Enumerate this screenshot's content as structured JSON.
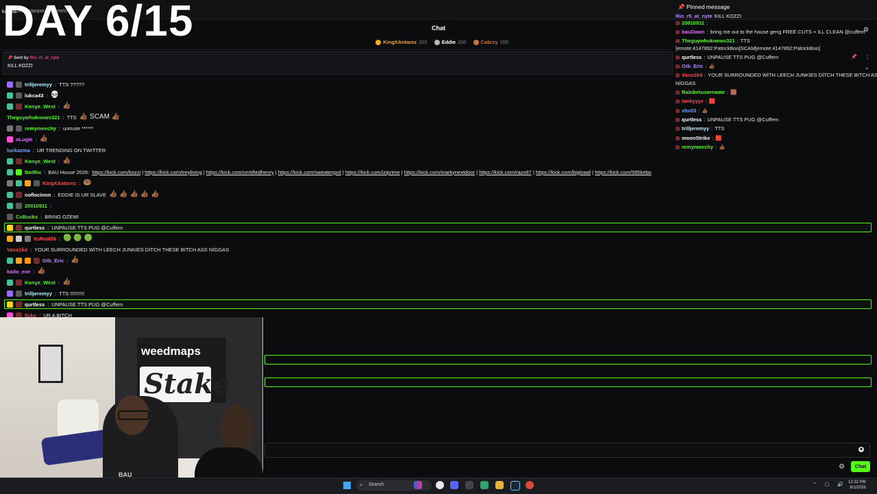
{
  "window": {
    "url": "kick.com/popout/cuffem/chat",
    "tab": "kick.co"
  },
  "overlay": {
    "day_counter": "DAY 6/15"
  },
  "chat_header": {
    "title": "Chat",
    "leaders": [
      {
        "name": "KingXAntarez",
        "points": "202",
        "color": "#f5a623"
      },
      {
        "name": "Eddie",
        "points": "200",
        "color": "#b8b8b8"
      },
      {
        "name": "Cabrzy",
        "points": "100",
        "color": "#c8743a"
      }
    ]
  },
  "main_pinned": {
    "sent_by_prefix": "Sent by",
    "sent_by_user": "Rio_r5_at_nyte",
    "message": "KILL KOZZI"
  },
  "messages": [
    {
      "user": "trilljeremyy",
      "color": "#b9f0ff",
      "text": "TTS ?????",
      "emote": "",
      "badges": [
        "#9b6bff",
        "#5a5a5a"
      ]
    },
    {
      "user": "lukca43",
      "color": "#ffffff",
      "text": "",
      "emote": "💀",
      "badges": [
        "#44c28f",
        "#5a5a5a"
      ]
    },
    {
      "user": "Konye_West",
      "color": "#53fc18",
      "text": "",
      "emote": "👍🏾",
      "badges": [
        "#44c28f",
        "#7a2a2a"
      ]
    },
    {
      "user": "Theguywhoknows321",
      "color": "#53fc18",
      "text": "TTS",
      "emote": "👍🏾 SCAM 👍🏾",
      "badges": []
    },
    {
      "user": "remymeechy",
      "color": "#53fc18",
      "text": "unmute ******",
      "emote": "",
      "badges": [
        "#777777",
        "#5a5a5a"
      ]
    },
    {
      "user": "oLugie",
      "color": "#e36bff",
      "text": "",
      "emote": "👍🏾",
      "badges": [
        "#ff4fd8"
      ]
    },
    {
      "user": "luckazma",
      "color": "#6fa8ff",
      "text": "UR TRENDING ON TWITTER",
      "emote": "",
      "badges": []
    },
    {
      "user": "Konye_West",
      "color": "#53fc18",
      "text": "",
      "emote": "👍🏾",
      "badges": [
        "#44c28f",
        "#7a2a2a"
      ]
    },
    {
      "user": "BotRix",
      "color": "#53fc18",
      "text": "BAU House 2026:",
      "emote": "",
      "badges": [
        "#44c28f",
        "#53fc18"
      ],
      "links": [
        "https://kick.com/kozzi",
        "https://kick.com/treyliving",
        "https://kick.com/certifiedhenry",
        "https://kick.com/sweatergxd",
        "https://kick.com/iziprime",
        "https://kick.com/markynextdoor",
        "https://kick.com/razo97",
        "https://kick.com/bigloaaf",
        "https://kick.com/595kebo"
      ]
    },
    {
      "user": "KingXAntarez",
      "color": "#ff4a4a",
      "text": "",
      "emote": "🍩",
      "badges": [
        "#7c7c7c",
        "#44c28f",
        "#f5a623",
        "#5a5a5a"
      ]
    },
    {
      "user": "noflocinnn",
      "color": "#ffffff",
      "text": "EDDIE IS UR SLAVE",
      "emote": "👍🏾 👍🏾 👍🏾 👍🏾 👍🏾",
      "badges": [
        "#44c28f",
        "#7a2a2a"
      ]
    },
    {
      "user": "20010911",
      "color": "#53fc18",
      "text": "",
      "emote": "",
      "badges": [
        "#44c28f",
        "#5a5a5a"
      ]
    },
    {
      "user": "CxBucks",
      "color": "#53fc18",
      "text": "BRING OZEMI",
      "emote": "",
      "badges": [
        "#5a5a5a"
      ]
    },
    {
      "user": "qurtless",
      "color": "#ffffff",
      "text": "UNPAUSE TTS PUG @Cuffem",
      "emote": "",
      "badges": [
        "#f5d623",
        "#7a2a2a"
      ],
      "highlight": true
    },
    {
      "user": "ItsReal26",
      "color": "#ff4a4a",
      "text": "",
      "emote": "🟢 🟢 🟢",
      "badges": [
        "#f5a623",
        "#cccccc",
        "#7c7c7c"
      ]
    },
    {
      "user": "Vaso1k4",
      "color": "#ff4a4a",
      "text": "YOUR SURROUNDED WİTH LEECH JUNKİES DİTCH THESE BITCH ASS NİGGAS",
      "emote": "",
      "badges": []
    },
    {
      "user": "Gtb_Eric",
      "color": "#b98cff",
      "text": "",
      "emote": "👍🏾",
      "badges": [
        "#44c28f",
        "#f5a623",
        "#ff9b00",
        "#7a2a2a"
      ]
    },
    {
      "user": "kado_exe",
      "color": "#e36bff",
      "text": "",
      "emote": "👍🏾",
      "badges": []
    },
    {
      "user": "Konye_West",
      "color": "#53fc18",
      "text": "",
      "emote": "👍🏾",
      "badges": [
        "#44c28f",
        "#7a2a2a"
      ]
    },
    {
      "user": "trilljeremyy",
      "color": "#b9f0ff",
      "text": "TTS !!!!!!!!!!",
      "emote": "",
      "badges": [
        "#9b6bff",
        "#5a5a5a"
      ]
    },
    {
      "user": "qurtless",
      "color": "#ffffff",
      "text": "UNPAUSE TTS PUG @Cuffem",
      "emote": "",
      "badges": [
        "#f5d623",
        "#7a2a2a"
      ],
      "highlight": true
    },
    {
      "user": "llcko",
      "color": "#ff4a4a",
      "text": "UR A BITCH",
      "emote": "",
      "badges": [
        "#ff4fd8",
        "#7a2a2a"
      ]
    }
  ],
  "side_chat": {
    "pinned_title": "Pinned message",
    "pinned_user": "Rio_r5_at_nyte",
    "pinned_text": "KILL KOZZI",
    "lines": [
      {
        "user": "20010911",
        "color": "#53fc18",
        "text": ""
      },
      {
        "user": "bauDawn",
        "color": "#e36bff",
        "text": "bring me out to the house geng FREE CUTS + ILL CLEAN @cuffem"
      },
      {
        "user": "Theguywhoknows321",
        "color": "#53fc18",
        "text": "TTS"
      },
      {
        "user": "",
        "color": "#e8e8e8",
        "text": "[emote:4147892:PatrickBoo]SCAM[emote:4147892:PatrickBoo]"
      },
      {
        "user": "qurtless",
        "color": "#ffffff",
        "text": "UNPAUSE TTS PUG @Cuffem"
      },
      {
        "user": "Gtb_Eric",
        "color": "#b98cff",
        "text": "👍🏾"
      },
      {
        "user": "Vaso1k4",
        "color": "#ff4a4a",
        "text": "YOUR SURROUNDED WİTH LEECH JUNKİES DİTCH THESE BITCH ASS"
      },
      {
        "user": "",
        "color": "#e8e8e8",
        "text": "NİGGAS"
      },
      {
        "user": "Rainbetusername",
        "color": "#53fc18",
        "text": "🟫"
      },
      {
        "user": "tankyyyz",
        "color": "#ff4a4a",
        "text": "🟥"
      },
      {
        "user": "xhx03",
        "color": "#6fa8ff",
        "text": "👍🏾"
      },
      {
        "user": "qurtless",
        "color": "#ffffff",
        "text": "UNPAUSE TTS PUG @Cuffem"
      },
      {
        "user": "trilljeremyy",
        "color": "#b9f0ff",
        "text": "TTS"
      },
      {
        "user": "moonStrike",
        "color": "#ffffff",
        "text": "🟥"
      },
      {
        "user": "remymeechy",
        "color": "#53fc18",
        "text": "👍🏾"
      }
    ]
  },
  "webcam": {
    "banner_brand_1": "weedmaps",
    "banner_brand_2": "Stake",
    "shirt_text": "BAU"
  },
  "chat_input": {
    "placeholder": "",
    "send_label": "Chat"
  },
  "taskbar": {
    "search_label": "Search",
    "time": "12:32 PM",
    "date": "8/1/2026"
  }
}
